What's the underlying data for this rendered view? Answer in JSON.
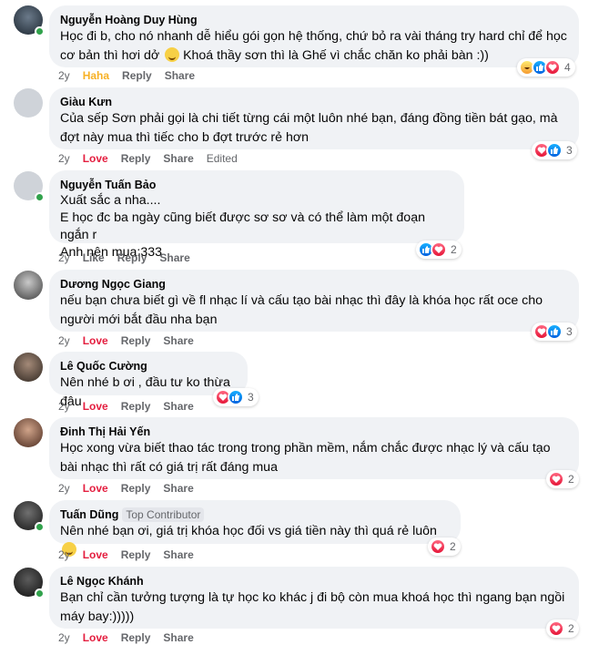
{
  "comments": [
    {
      "author": "Nguyễn Hoàng Duy Hùng",
      "badge": "",
      "text": "Học đi b, cho nó nhanh dễ hiểu gói gọn hệ thống, chứ bỏ ra vài tháng try hard chỉ để học cơ bản thì hơi dở",
      "text_tail": "Khoá thầy sơn thì là Ghế vì chắc chăn ko phải bàn :))",
      "time": "2y",
      "reaction_label": "Haha",
      "reply": "Reply",
      "share": "Share",
      "edited": "",
      "reactions": [
        "haha",
        "like",
        "love"
      ],
      "reaction_count": "4",
      "online": true
    },
    {
      "author": "Giàu Kưn",
      "text": "Của sếp Sơn phải gọi là chi tiết từng cái một luôn nhé bạn, đáng đồng tiền bát gạo, mà đợt này mua thì tiếc cho b đợt trước rẻ hơn",
      "time": "2y",
      "reaction_label": "Love",
      "reply": "Reply",
      "share": "Share",
      "edited": "Edited",
      "reactions": [
        "love",
        "like"
      ],
      "reaction_count": "3",
      "online": false
    },
    {
      "author": "Nguyễn Tuấn Bảo",
      "text": "Xuất sắc a nha....\nE học đc ba ngày cũng biết được sơ sơ và có thể làm một đoạn ngắn r\nAnh nên mua:333",
      "time": "2y",
      "reaction_label": "Like",
      "reply": "Reply",
      "share": "Share",
      "reactions": [
        "like",
        "love"
      ],
      "reaction_count": "2",
      "online": true
    },
    {
      "author": "Dương Ngọc Giang",
      "text": "nếu bạn chưa biết gì về fl nhạc lí và cấu tạo bài nhạc thì đây là khóa học rất oce cho người mới bắt đầu nha bạn",
      "time": "2y",
      "reaction_label": "Love",
      "reply": "Reply",
      "share": "Share",
      "reactions": [
        "love",
        "like"
      ],
      "reaction_count": "3",
      "online": false
    },
    {
      "author": "Lê Quốc Cường",
      "text": "Nên nhé b ơi , đầu tư ko thừa đâu",
      "time": "2y",
      "reaction_label": "Love",
      "reply": "Reply",
      "share": "Share",
      "reactions": [
        "love",
        "like"
      ],
      "reaction_count": "3",
      "online": false
    },
    {
      "author": "Đinh Thị Hải Yến",
      "text": "Học xong vừa biết thao tác trong trong phần mềm, nắm chắc được nhạc lý và cấu tạo bài nhạc thì rất có giá trị rất đáng mua",
      "time": "2y",
      "reaction_label": "Love",
      "reply": "Reply",
      "share": "Share",
      "reactions": [
        "love"
      ],
      "reaction_count": "2",
      "online": false
    },
    {
      "author": "Tuấn Dũng",
      "badge": "Top Contributor",
      "text": "Nên nhé bạn ơi, giá trị khóa học đối vs giá tiền này thì quá rẻ luôn",
      "time": "2y",
      "reaction_label": "Love",
      "reply": "Reply",
      "share": "Share",
      "reactions": [
        "love"
      ],
      "reaction_count": "2",
      "online": true
    },
    {
      "author": "Lê Ngọc Khánh",
      "text": "Bạn chỉ cần tưởng tượng là tự học ko khác j đi bộ còn mua khoá học thì ngang bạn ngồi máy bay:)))))",
      "time": "2y",
      "reaction_label": "Love",
      "reply": "Reply",
      "share": "Share",
      "reactions": [
        "love"
      ],
      "reaction_count": "2",
      "online": true
    }
  ],
  "colors": {
    "bubble": "#f0f2f5",
    "love": "#e41e3f",
    "haha": "#f7b125",
    "like": "#0866ff",
    "muted": "#65676b",
    "online": "#31a24c"
  }
}
